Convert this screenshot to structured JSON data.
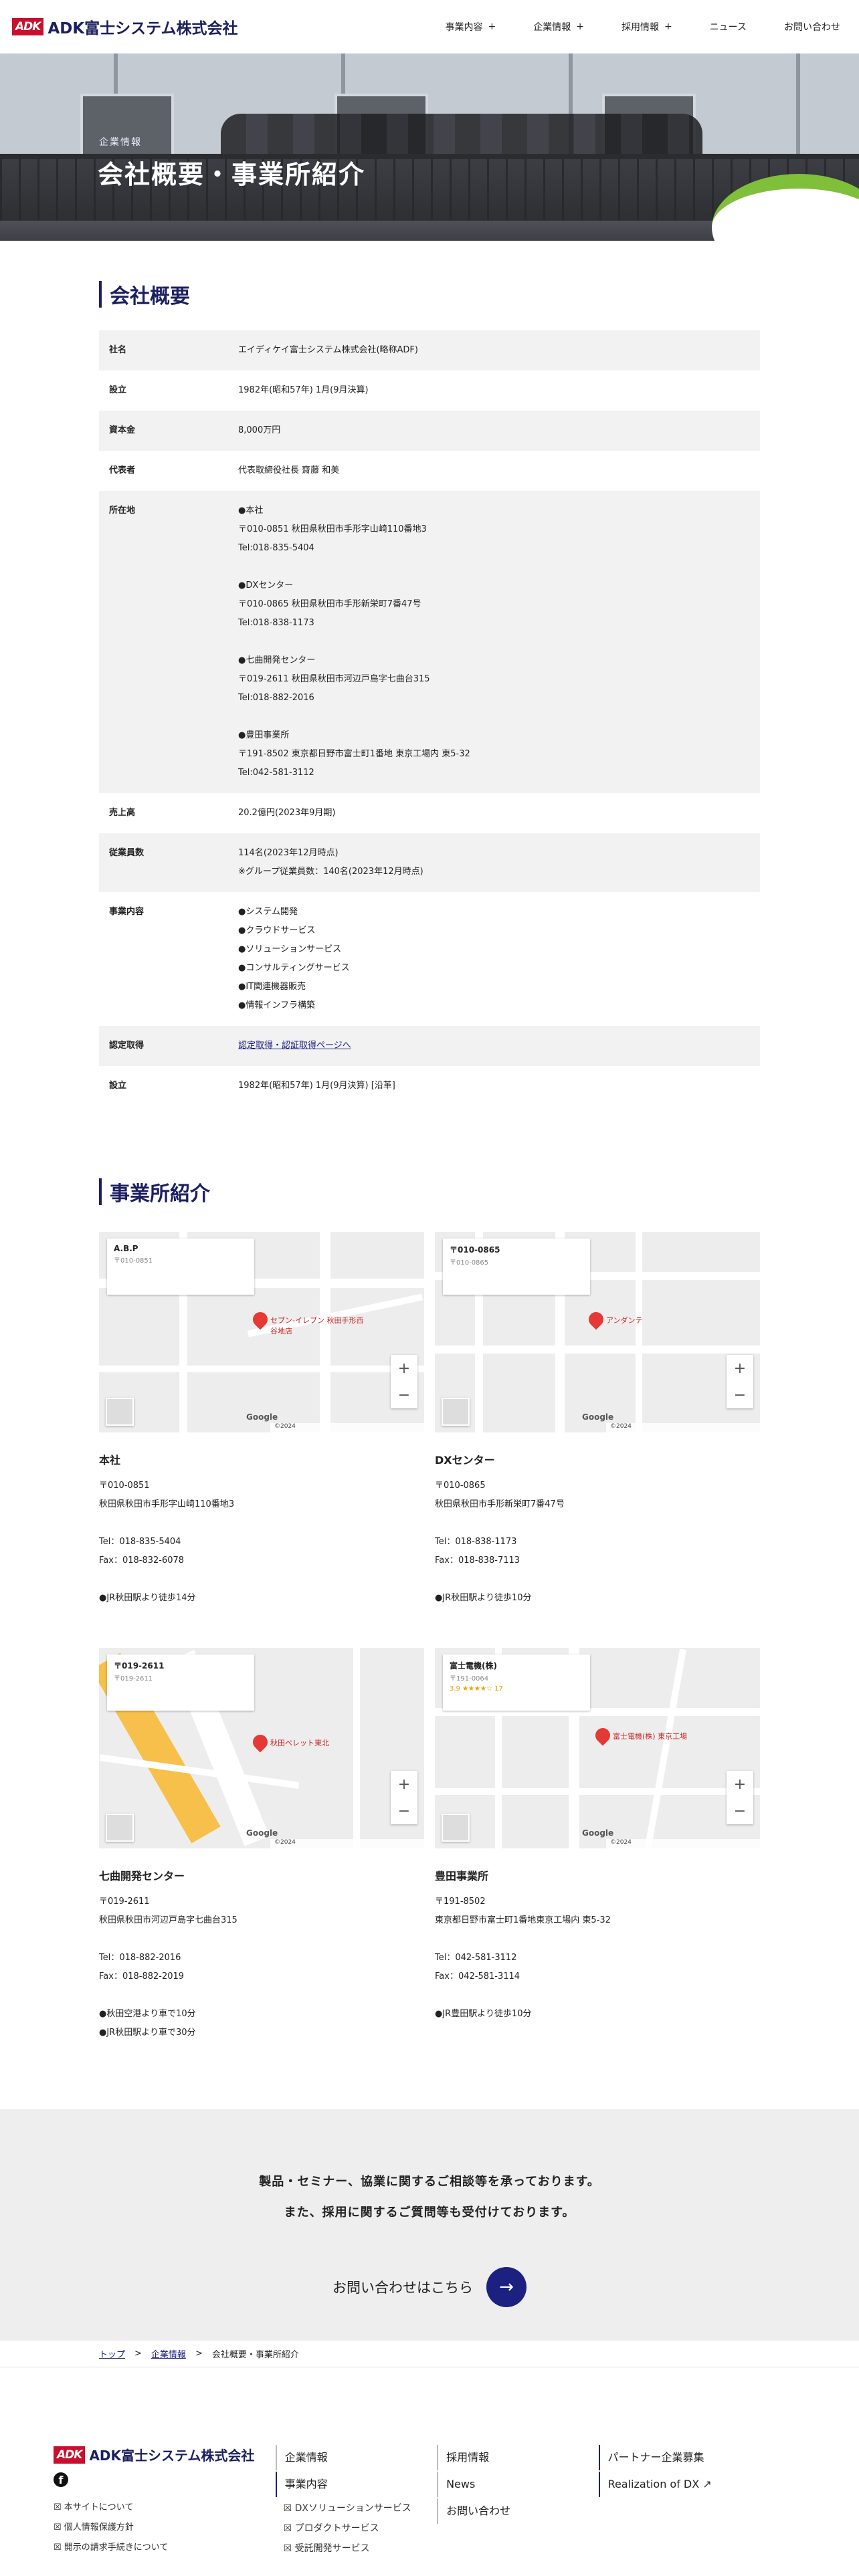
{
  "brand": {
    "mark": "ADK",
    "name": "ADK富士システム株式会社"
  },
  "nav": [
    {
      "label": "事業内容",
      "plus": "+"
    },
    {
      "label": "企業情報",
      "plus": "+"
    },
    {
      "label": "採用情報",
      "plus": "+"
    },
    {
      "label": "ニュース",
      "plus": ""
    },
    {
      "label": "お問い合わせ",
      "plus": ""
    }
  ],
  "hero": {
    "subtitle": "企業情報",
    "title": "会社概要・事業所紹介"
  },
  "overview": {
    "heading": "会社概要",
    "rows": [
      {
        "k": "社名",
        "v": [
          "エイディケイ富士システム株式会社(略称ADF)"
        ]
      },
      {
        "k": "設立",
        "v": [
          "1982年(昭和57年) 1月(9月決算)"
        ]
      },
      {
        "k": "資本金",
        "v": [
          "8,000万円"
        ]
      },
      {
        "k": "代表者",
        "v": [
          "代表取締役社長 齋藤 和美"
        ]
      },
      {
        "k": "所在地",
        "v": [
          "●本社",
          "〒010-0851 秋田県秋田市手形字山崎110番地3",
          "Tel:018-835-5404",
          "",
          "●DXセンター",
          "〒010-0865 秋田県秋田市手形新栄町7番47号",
          "Tel:018-838-1173",
          "",
          "●七曲開発センター",
          "〒019-2611 秋田県秋田市河辺戸島字七曲台315",
          "Tel:018-882-2016",
          "",
          "●豊田事業所",
          "〒191-8502 東京都日野市富士町1番地 東京工場内 東5-32",
          "Tel:042-581-3112"
        ]
      },
      {
        "k": "売上高",
        "v": [
          "20.2億円(2023年9月期)"
        ]
      },
      {
        "k": "従業員数",
        "v": [
          "114名(2023年12月時点)",
          "※グループ従業員数：140名(2023年12月時点)"
        ]
      },
      {
        "k": "事業内容",
        "v": [
          "●システム開発",
          "●クラウドサービス",
          "●ソリューションサービス",
          "●コンサルティングサービス",
          "●IT関連機器販売",
          "●情報インフラ構築"
        ]
      },
      {
        "k": "認定取得",
        "link": "認定取得・認証取得ページへ"
      },
      {
        "k": "設立",
        "v": [
          "1982年(昭和57年) 1月(9月決算) [沿革]"
        ]
      }
    ]
  },
  "offices": {
    "heading": "事業所紹介",
    "items": [
      {
        "name": "本社",
        "lines": [
          "〒010-0851",
          "秋田県秋田市手形字山崎110番地3",
          "",
          "Tel：018-835-5404",
          "Fax：018-832-6078",
          "",
          "●JR秋田駅より徒歩14分"
        ],
        "map": {
          "card": "A.B.P",
          "card_sub": "〒010-0851",
          "label": "セブン-イレブン 秋田手形西谷地店",
          "year": "©2024"
        }
      },
      {
        "name": "DXセンター",
        "lines": [
          "〒010-0865",
          "秋田県秋田市手形新栄町7番47号",
          "",
          "Tel：018-838-1173",
          "Fax：018-838-7113",
          "",
          "●JR秋田駅より徒歩10分"
        ],
        "map": {
          "card": "〒010-0865",
          "card_sub": "〒010-0865",
          "label": "アンダンテ",
          "year": "©2024"
        }
      },
      {
        "name": "七曲開発センター",
        "lines": [
          "〒019-2611",
          "秋田県秋田市河辺戸島字七曲台315",
          "",
          "Tel：018-882-2016",
          "Fax：018-882-2019",
          "",
          "●秋田空港より車で10分",
          "●JR秋田駅より車で30分"
        ],
        "map": {
          "card": "〒019-2611",
          "card_sub": "〒019-2611",
          "label": "秋田ベレット東北",
          "year": "©2024"
        }
      },
      {
        "name": "豊田事業所",
        "lines": [
          "〒191-8502",
          "東京都日野市富士町1番地東京工場内 東5-32",
          "",
          "Tel：042-581-3112",
          "Fax：042-581-3114",
          "",
          "●JR豊田駅より徒歩10分"
        ],
        "map": {
          "card": "富士電機(株)",
          "card_sub": "〒191-0064",
          "label": "富士電機(株) 東京工場",
          "year": "©2024",
          "rating": "3.9 ★★★★☆ 17"
        }
      }
    ]
  },
  "contact": {
    "line1": "製品・セミナー、協業に関するご相談等を承っております。",
    "line2": "また、採用に関するご質問等も受付けております。",
    "cta": "お問い合わせはこちら",
    "arrow": "→"
  },
  "breadcrumb": {
    "home": "トップ",
    "parent": "企業情報",
    "sep": ">",
    "current": "会社概要・事業所紹介"
  },
  "footer": {
    "fb": "f",
    "links": [
      "☒ 本サイトについて",
      "☒ 個人情報保護方針",
      "☒ 開示の請求手続きについて"
    ],
    "col2": {
      "h1": "企業情報",
      "h2": "事業内容",
      "subs": [
        "☒ DXソリューションサービス",
        "☒ プロダクトサービス",
        "☒ 受託開発サービス"
      ]
    },
    "col3": [
      "採用情報",
      "News",
      "お問い合わせ"
    ],
    "col4": [
      "パートナー企業募集",
      "Realization of DX ↗"
    ]
  },
  "colors": {
    "brand": "#1c2060",
    "accent": "#c8102e",
    "link": "#1c2080"
  }
}
